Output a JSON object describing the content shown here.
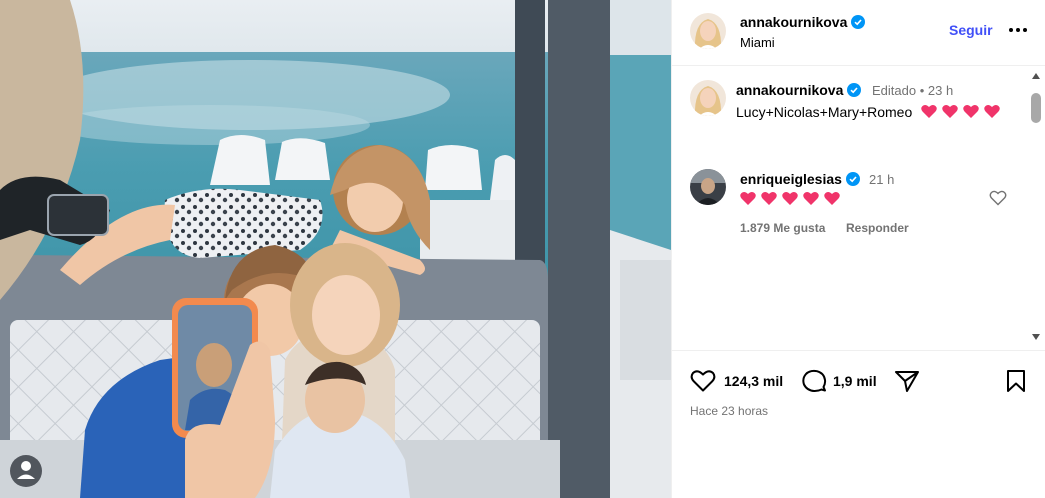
{
  "post": {
    "author": "annakournikova",
    "location": "Miami",
    "follow_label": "Seguir",
    "more_icon": "more-horizontal-icon",
    "verified_color": "#0095f6",
    "follow_color": "#4150f7"
  },
  "comments": [
    {
      "author": "annakournikova",
      "meta": "Editado • 23 h",
      "text": "Lucy+Nicolas+Mary+Romeo",
      "emoji": [
        "heart-emoji",
        "heart-emoji",
        "heart-emoji",
        "heart-emoji"
      ]
    },
    {
      "author": "enriqueiglesias",
      "time": "21 h",
      "emoji": [
        "heart-emoji",
        "heart-emoji",
        "heart-emoji",
        "heart-emoji",
        "heart-emoji"
      ],
      "likes": "1.879 Me gusta",
      "reply_label": "Responder"
    }
  ],
  "actions": {
    "like_count": "124,3 mil",
    "comment_count": "1,9 mil",
    "posted_ago": "Hace 23 horas",
    "icons": [
      "heart-outline-icon",
      "comment-icon",
      "share-icon",
      "bookmark-icon"
    ]
  },
  "colors": {
    "emoji_heart": "#f0346a",
    "muted_text": "#737373"
  }
}
